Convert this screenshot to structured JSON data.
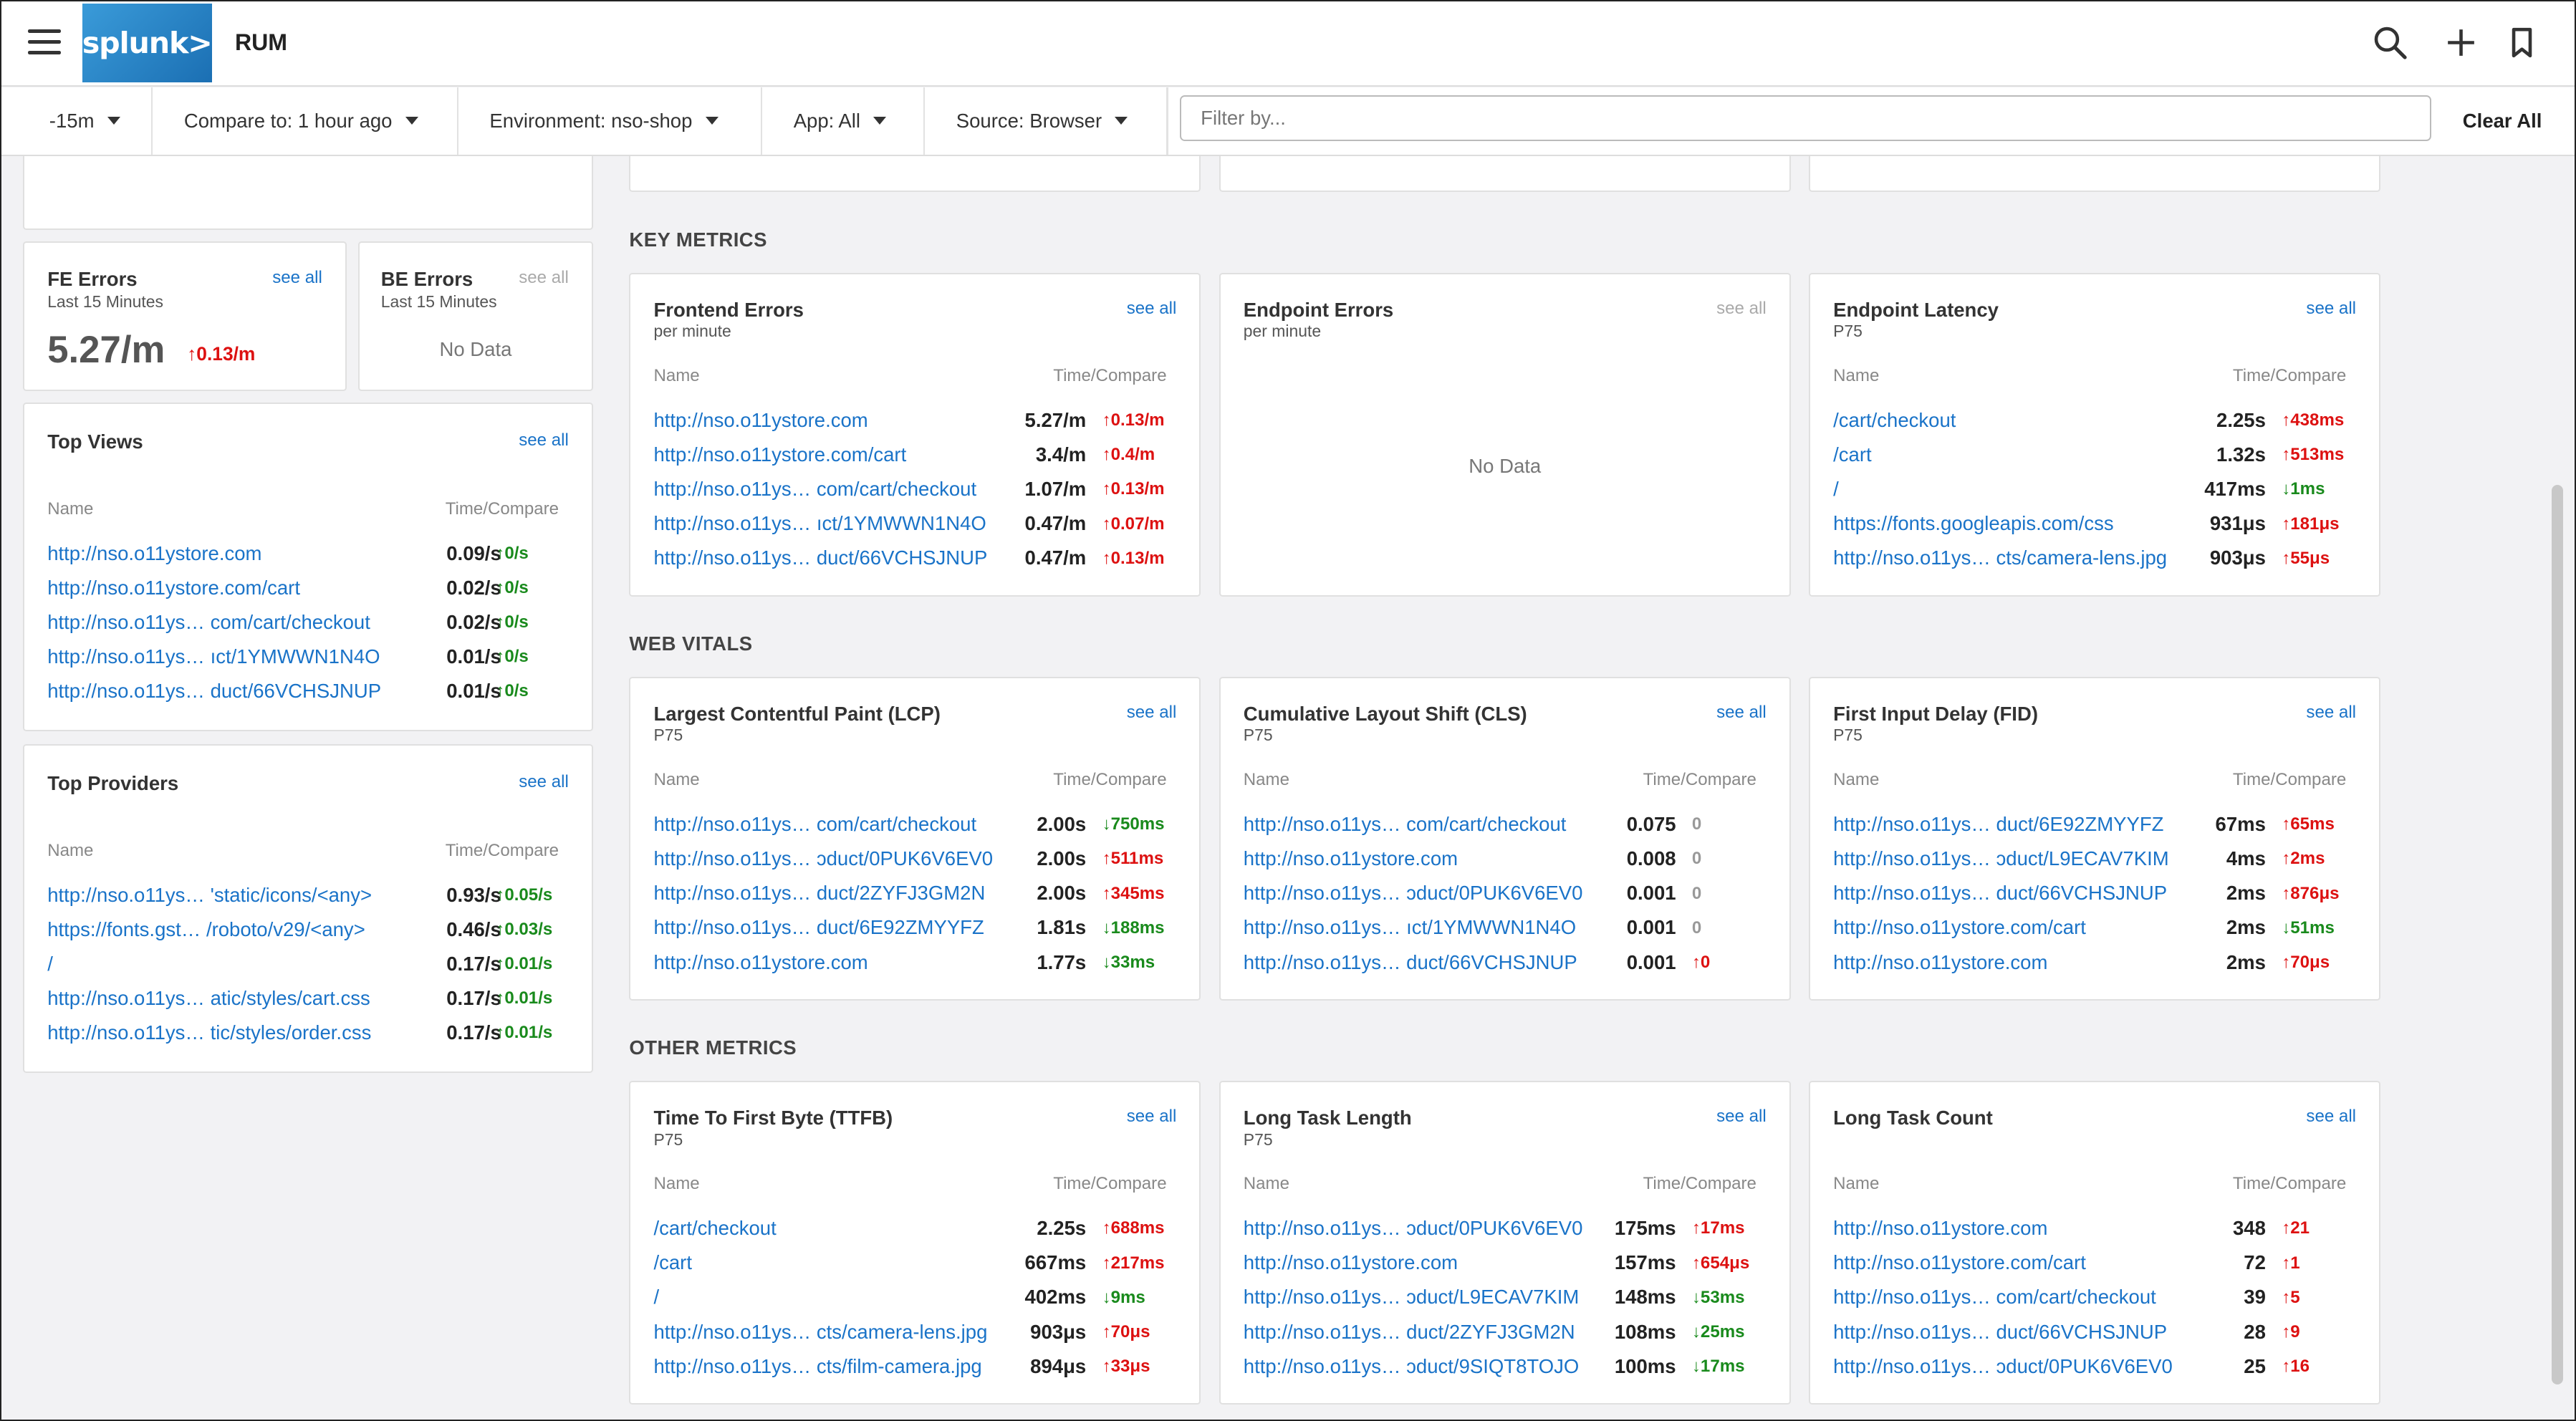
{
  "header": {
    "logo": "splunk>",
    "title": "RUM"
  },
  "filters": {
    "time": "-15m",
    "compare": "Compare to: 1 hour ago",
    "environment": "Environment: nso-shop",
    "app": "App: All",
    "source": "Source: Browser",
    "filter_placeholder": "Filter by...",
    "clear_all": "Clear All"
  },
  "left": {
    "fe_errors": {
      "title": "FE Errors",
      "sub": "Last 15 Minutes",
      "see_all": "see all",
      "value": "5.27/m",
      "compare": "↑0.13/m"
    },
    "be_errors": {
      "title": "BE Errors",
      "sub": "Last 15 Minutes",
      "see_all": "see all",
      "nodata": "No Data"
    },
    "top_views": {
      "title": "Top Views",
      "see_all": "see all",
      "col_name": "Name",
      "col_time": "Time/Compare",
      "rows": [
        {
          "name": "http://nso.o11ystore.com",
          "val": "0.09/s",
          "cmp": "↑0/s"
        },
        {
          "name": "http://nso.o11ystore.com/cart",
          "val": "0.02/s",
          "cmp": "↑0/s"
        },
        {
          "name": "http://nso.o11ys… com/cart/checkout",
          "val": "0.02/s",
          "cmp": "↑0/s"
        },
        {
          "name": "http://nso.o11ys… ıct/1YMWWN1N4O",
          "val": "0.01/s",
          "cmp": "↑0/s"
        },
        {
          "name": "http://nso.o11ys… duct/66VCHSJNUP",
          "val": "0.01/s",
          "cmp": "↑0/s"
        }
      ]
    },
    "top_providers": {
      "title": "Top Providers",
      "see_all": "see all",
      "col_name": "Name",
      "col_time": "Time/Compare",
      "rows": [
        {
          "name": "http://nso.o11ys… 'static/icons/<any>",
          "val": "0.93/s",
          "cmp": "↑0.05/s"
        },
        {
          "name": "https://fonts.gst… /roboto/v29/<any>",
          "val": "0.46/s",
          "cmp": "↑0.03/s"
        },
        {
          "name": "/",
          "val": "0.17/s",
          "cmp": "↑0.01/s"
        },
        {
          "name": "http://nso.o11ys… atic/styles/cart.css",
          "val": "0.17/s",
          "cmp": "↑0.01/s"
        },
        {
          "name": "http://nso.o11ys… tic/styles/order.css",
          "val": "0.17/s",
          "cmp": "↑0.01/s"
        }
      ]
    }
  },
  "sections": {
    "key": "KEY METRICS",
    "web": "WEB VITALS",
    "other": "OTHER METRICS"
  },
  "cards": {
    "frontend_errors": {
      "title": "Frontend Errors",
      "sub": "per minute",
      "see_all": "see all",
      "col_name": "Name",
      "col_time": "Time/Compare",
      "rows": [
        {
          "name": "http://nso.o11ystore.com",
          "val": "5.27/m",
          "cmp": "↑0.13/m",
          "cls": "up-red"
        },
        {
          "name": "http://nso.o11ystore.com/cart",
          "val": "3.4/m",
          "cmp": "↑0.4/m",
          "cls": "up-red"
        },
        {
          "name": "http://nso.o11ys… com/cart/checkout",
          "val": "1.07/m",
          "cmp": "↑0.13/m",
          "cls": "up-red"
        },
        {
          "name": "http://nso.o11ys… ıct/1YMWWN1N4O",
          "val": "0.47/m",
          "cmp": "↑0.07/m",
          "cls": "up-red"
        },
        {
          "name": "http://nso.o11ys… duct/66VCHSJNUP",
          "val": "0.47/m",
          "cmp": "↑0.13/m",
          "cls": "up-red"
        }
      ]
    },
    "endpoint_errors": {
      "title": "Endpoint Errors",
      "sub": "per minute",
      "see_all": "see all",
      "nodata": "No Data"
    },
    "endpoint_latency": {
      "title": "Endpoint Latency",
      "sub": "P75",
      "see_all": "see all",
      "col_name": "Name",
      "col_time": "Time/Compare",
      "rows": [
        {
          "name": "/cart/checkout",
          "val": "2.25s",
          "cmp": "↑438ms",
          "cls": "up-red"
        },
        {
          "name": "/cart",
          "val": "1.32s",
          "cmp": "↑513ms",
          "cls": "up-red"
        },
        {
          "name": "/",
          "val": "417ms",
          "cmp": "↓1ms",
          "cls": "down-green"
        },
        {
          "name": "https://fonts.googleapis.com/css",
          "val": "931μs",
          "cmp": "↑181μs",
          "cls": "up-red"
        },
        {
          "name": "http://nso.o11ys… cts/camera-lens.jpg",
          "val": "903μs",
          "cmp": "↑55μs",
          "cls": "up-red"
        }
      ]
    },
    "lcp": {
      "title": "Largest Contentful Paint (LCP)",
      "sub": "P75",
      "see_all": "see all",
      "col_name": "Name",
      "col_time": "Time/Compare",
      "rows": [
        {
          "name": "http://nso.o11ys… com/cart/checkout",
          "val": "2.00s",
          "cmp": "↓750ms",
          "cls": "down-green"
        },
        {
          "name": "http://nso.o11ys… ɔduct/0PUK6V6EV0",
          "val": "2.00s",
          "cmp": "↑511ms",
          "cls": "up-red"
        },
        {
          "name": "http://nso.o11ys… duct/2ZYFJ3GM2N",
          "val": "2.00s",
          "cmp": "↑345ms",
          "cls": "up-red"
        },
        {
          "name": "http://nso.o11ys… duct/6E92ZMYYFZ",
          "val": "1.81s",
          "cmp": "↓188ms",
          "cls": "down-green"
        },
        {
          "name": "http://nso.o11ystore.com",
          "val": "1.77s",
          "cmp": "↓33ms",
          "cls": "down-green"
        }
      ]
    },
    "cls": {
      "title": "Cumulative Layout Shift (CLS)",
      "sub": "P75",
      "see_all": "see all",
      "col_name": "Name",
      "col_time": "Time/Compare",
      "rows": [
        {
          "name": "http://nso.o11ys… com/cart/checkout",
          "val": "0.075",
          "cmp": "0",
          "cls": "neutral"
        },
        {
          "name": "http://nso.o11ystore.com",
          "val": "0.008",
          "cmp": "0",
          "cls": "neutral"
        },
        {
          "name": "http://nso.o11ys… ɔduct/0PUK6V6EV0",
          "val": "0.001",
          "cmp": "0",
          "cls": "neutral"
        },
        {
          "name": "http://nso.o11ys… ıct/1YMWWN1N4O",
          "val": "0.001",
          "cmp": "0",
          "cls": "neutral"
        },
        {
          "name": "http://nso.o11ys… duct/66VCHSJNUP",
          "val": "0.001",
          "cmp": "↑0",
          "cls": "up-red"
        }
      ]
    },
    "fid": {
      "title": "First Input Delay (FID)",
      "sub": "P75",
      "see_all": "see all",
      "col_name": "Name",
      "col_time": "Time/Compare",
      "rows": [
        {
          "name": "http://nso.o11ys… duct/6E92ZMYYFZ",
          "val": "67ms",
          "cmp": "↑65ms",
          "cls": "up-red"
        },
        {
          "name": "http://nso.o11ys… ɔduct/L9ECAV7KIM",
          "val": "4ms",
          "cmp": "↑2ms",
          "cls": "up-red"
        },
        {
          "name": "http://nso.o11ys… duct/66VCHSJNUP",
          "val": "2ms",
          "cmp": "↑876μs",
          "cls": "up-red"
        },
        {
          "name": "http://nso.o11ystore.com/cart",
          "val": "2ms",
          "cmp": "↓51ms",
          "cls": "down-green"
        },
        {
          "name": "http://nso.o11ystore.com",
          "val": "2ms",
          "cmp": "↑70μs",
          "cls": "up-red"
        }
      ]
    },
    "ttfb": {
      "title": "Time To First Byte (TTFB)",
      "sub": "P75",
      "see_all": "see all",
      "col_name": "Name",
      "col_time": "Time/Compare",
      "rows": [
        {
          "name": "/cart/checkout",
          "val": "2.25s",
          "cmp": "↑688ms",
          "cls": "up-red"
        },
        {
          "name": "/cart",
          "val": "667ms",
          "cmp": "↑217ms",
          "cls": "up-red"
        },
        {
          "name": "/",
          "val": "402ms",
          "cmp": "↓9ms",
          "cls": "down-green"
        },
        {
          "name": "http://nso.o11ys… cts/camera-lens.jpg",
          "val": "903μs",
          "cmp": "↑70μs",
          "cls": "up-red"
        },
        {
          "name": "http://nso.o11ys… cts/film-camera.jpg",
          "val": "894μs",
          "cmp": "↑33μs",
          "cls": "up-red"
        }
      ]
    },
    "long_task_length": {
      "title": "Long Task Length",
      "sub": "P75",
      "see_all": "see all",
      "col_name": "Name",
      "col_time": "Time/Compare",
      "rows": [
        {
          "name": "http://nso.o11ys… ɔduct/0PUK6V6EV0",
          "val": "175ms",
          "cmp": "↑17ms",
          "cls": "up-red"
        },
        {
          "name": "http://nso.o11ystore.com",
          "val": "157ms",
          "cmp": "↑654μs",
          "cls": "up-red"
        },
        {
          "name": "http://nso.o11ys… ɔduct/L9ECAV7KIM",
          "val": "148ms",
          "cmp": "↓53ms",
          "cls": "down-green"
        },
        {
          "name": "http://nso.o11ys… duct/2ZYFJ3GM2N",
          "val": "108ms",
          "cmp": "↓25ms",
          "cls": "down-green"
        },
        {
          "name": "http://nso.o11ys… ɔduct/9SIQT8TOJO",
          "val": "100ms",
          "cmp": "↓17ms",
          "cls": "down-green"
        }
      ]
    },
    "long_task_count": {
      "title": "Long Task Count",
      "sub": "",
      "see_all": "see all",
      "col_name": "Name",
      "col_time": "Time/Compare",
      "rows": [
        {
          "name": "http://nso.o11ystore.com",
          "val": "348",
          "cmp": "↑21",
          "cls": "up-red"
        },
        {
          "name": "http://nso.o11ystore.com/cart",
          "val": "72",
          "cmp": "↑1",
          "cls": "up-red"
        },
        {
          "name": "http://nso.o11ys… com/cart/checkout",
          "val": "39",
          "cmp": "↑5",
          "cls": "up-red"
        },
        {
          "name": "http://nso.o11ys… duct/66VCHSJNUP",
          "val": "28",
          "cmp": "↑9",
          "cls": "up-red"
        },
        {
          "name": "http://nso.o11ys… ɔduct/0PUK6V6EV0",
          "val": "25",
          "cmp": "↑16",
          "cls": "up-red"
        }
      ]
    }
  }
}
